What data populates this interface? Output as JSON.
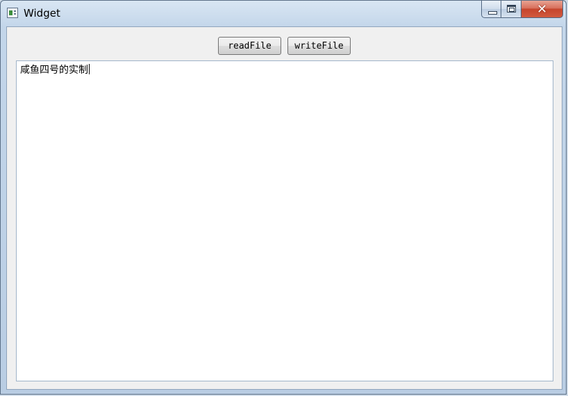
{
  "window": {
    "title": "Widget",
    "icon": "app-window-icon",
    "caption_buttons": {
      "minimize_icon": "minimize-icon",
      "maximize_icon": "maximize-icon",
      "close_icon": "close-icon",
      "close_glyph": "✕"
    }
  },
  "toolbar": {
    "read_label": "readFile",
    "write_label": "writeFile"
  },
  "editor": {
    "text": "咸鱼四号的实制"
  },
  "colors": {
    "close_button": "#c5452d",
    "client_background": "#f0f0f0",
    "editor_border": "#9fb3c8"
  }
}
